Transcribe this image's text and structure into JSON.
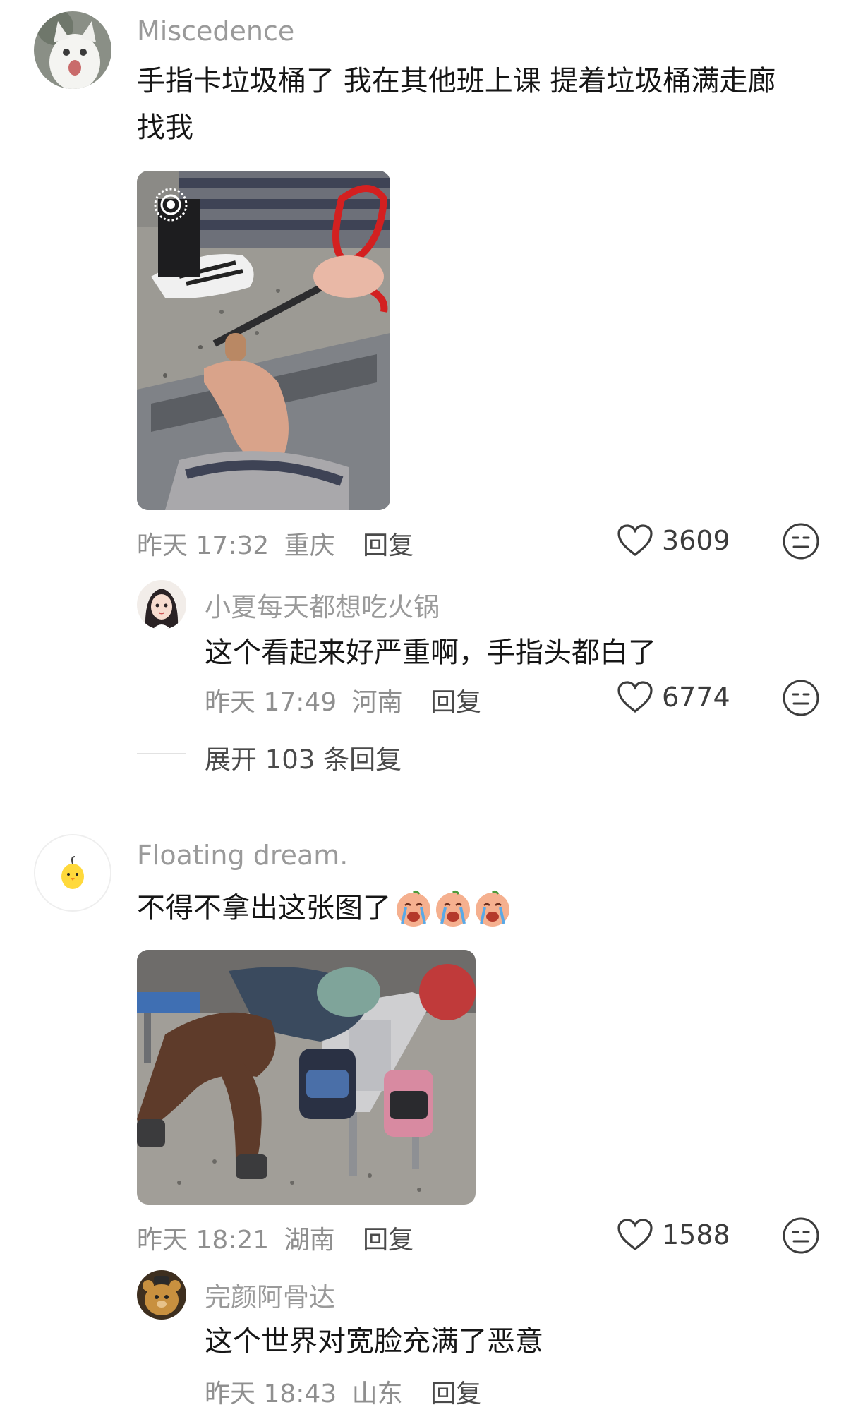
{
  "comments": [
    {
      "username": "Miscedence",
      "text_line1": "手指卡垃圾桶了 我在其他班上课 提着垃圾桶满走廊",
      "text_line2": "找我",
      "time": "昨天 17:32",
      "location": "重庆",
      "reply_label": "回复",
      "likes": "3609",
      "replies": [
        {
          "username": "小夏每天都想吃火锅",
          "text": "这个看起来好严重啊，手指头都白了",
          "time": "昨天 17:49",
          "location": "河南",
          "reply_label": "回复",
          "likes": "6774"
        }
      ],
      "expand_label": "展开 103 条回复"
    },
    {
      "username": "Floating dream.",
      "text": "不得不拿出这张图了",
      "time": "昨天 18:21",
      "location": "湖南",
      "reply_label": "回复",
      "likes": "1588",
      "replies": [
        {
          "username": "完颜阿骨达",
          "text": "这个世界对宽脸充满了恶意",
          "time": "昨天 18:43",
          "location": "山东",
          "reply_label": "回复"
        }
      ]
    }
  ],
  "icons": {
    "like": "heart-outline-icon",
    "react": "neutral-face-icon",
    "live_photo": "live-photo-icon",
    "crying_emoji": "crying-face-emoji"
  },
  "colors": {
    "username": "#9a9a9a",
    "text": "#161616",
    "meta": "#8f8f8f"
  }
}
